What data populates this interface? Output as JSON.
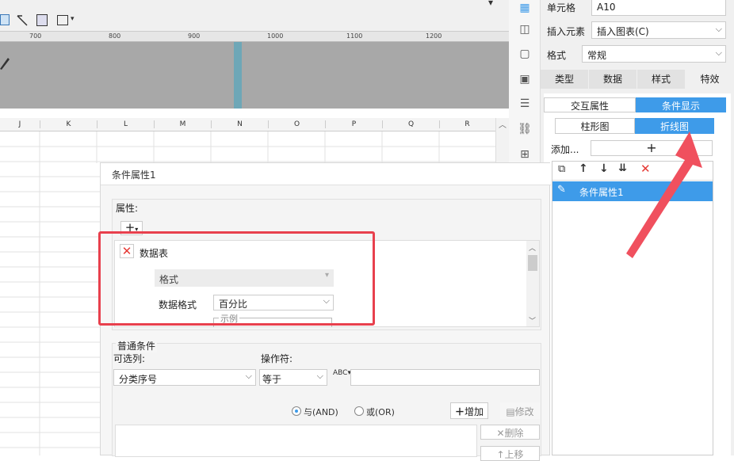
{
  "ruler": {
    "ticks": [
      "700",
      "800",
      "900",
      "1000",
      "1100",
      "1200"
    ]
  },
  "columns": [
    "J",
    "K",
    "L",
    "M",
    "N",
    "O",
    "P",
    "Q",
    "R"
  ],
  "right_panel": {
    "cell_label": "单元格",
    "cell_value": "A10",
    "insert_label": "插入元素",
    "insert_value": "插入图表(C)",
    "format_label": "格式",
    "format_value": "常规",
    "tabs": [
      "类型",
      "数据",
      "样式",
      "特效"
    ],
    "mode_tabs": [
      "交互属性",
      "条件显示"
    ],
    "chart_tabs": [
      "柱形图",
      "折线图"
    ],
    "add_label": "添加...",
    "add_button": "+",
    "list_items": [
      "条件属性1"
    ]
  },
  "dialog": {
    "title": "条件属性1",
    "attr_label": "属性:",
    "add_btn": "+",
    "data_table_label": "数据表",
    "format_combo": "格式",
    "data_format_label": "数据格式",
    "data_format_value": "百分比",
    "example_label": "示例",
    "normal_condition": "普通条件",
    "optional_cols_label": "可选列:",
    "operator_label": "操作符:",
    "column_value": "分类序号",
    "operator_value": "等于",
    "and_label": "与(AND)",
    "or_label": "或(OR)",
    "add_condition": "增加",
    "modify": "修改",
    "delete": "删除",
    "move_up": "上移"
  },
  "colors": {
    "accent": "#3e9be9",
    "highlight": "#e8404d"
  }
}
